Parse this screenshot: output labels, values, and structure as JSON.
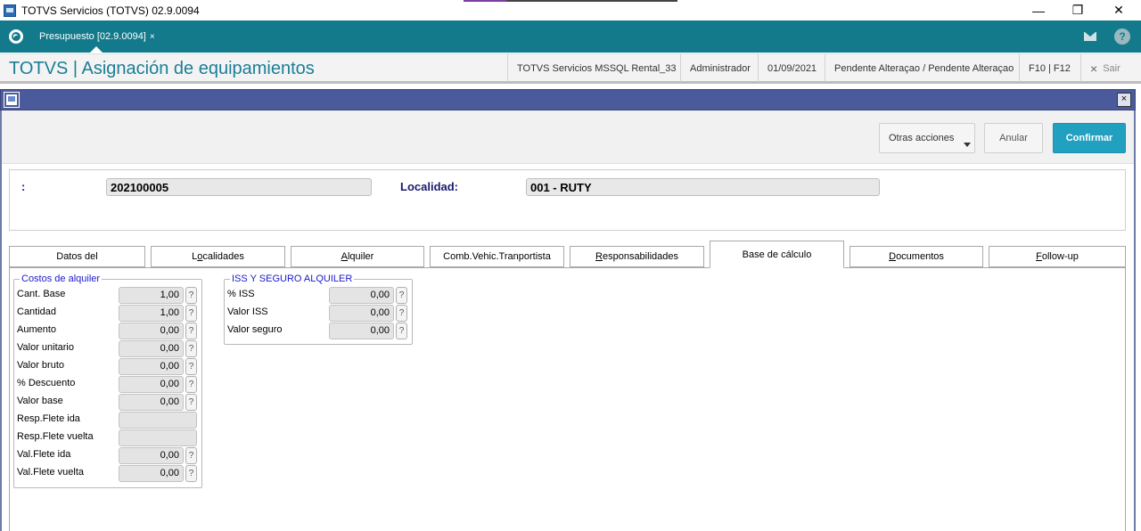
{
  "window": {
    "title": "TOTVS Servicios (TOTVS) 02.9.0094",
    "minimize": "—",
    "restore": "❐",
    "close": "✕"
  },
  "app_tabs": [
    {
      "label": "Presupuesto [02.9.0094]",
      "close": "×"
    }
  ],
  "header": {
    "title": "TOTVS | Asignación de equipamientos",
    "environment": "TOTVS Servicios MSSQL Rental_33",
    "user": "Administrador",
    "date": "01/09/2021",
    "status": "Pendente Alteraçao / Pendente Alteraçao",
    "shortcuts": "F10 | F12",
    "exit_label": "Sair",
    "exit_icon": "×",
    "help_icon": "?"
  },
  "toolbar": {
    "other_actions": "Otras acciones",
    "cancel": "Anular",
    "confirm": "Confirmar"
  },
  "dialog": {
    "close": "×"
  },
  "fields": {
    "number_label": ":",
    "number_value": "202100005",
    "locality_label": "Localidad:",
    "locality_value": "001 - RUTY"
  },
  "tabs": [
    {
      "label_pre": "Datos del",
      "label_u": " ",
      "label_post": ""
    },
    {
      "label_pre": "L",
      "label_u": "o",
      "label_post": "calidades"
    },
    {
      "label_pre": "",
      "label_u": "A",
      "label_post": "lquiler"
    },
    {
      "label_pre": "Comb.Vehic.Tranportista",
      "label_u": "",
      "label_post": ""
    },
    {
      "label_pre": "",
      "label_u": "R",
      "label_post": "esponsabilidades"
    },
    {
      "label_pre": "Base de cálculo",
      "label_u": "",
      "label_post": ""
    },
    {
      "label_pre": "",
      "label_u": "D",
      "label_post": "ocumentos"
    },
    {
      "label_pre": "",
      "label_u": "F",
      "label_post": "ollow-up"
    }
  ],
  "active_tab": "Base de cálculo",
  "costos": {
    "title": "Costos de alquiler",
    "rows": [
      {
        "label": "Cant. Base",
        "value": "1,00",
        "help": "?"
      },
      {
        "label": "Cantidad",
        "value": "1,00",
        "help": "?"
      },
      {
        "label": "Aumento",
        "value": "0,00",
        "help": "?"
      },
      {
        "label": "Valor unitario",
        "value": "0,00",
        "help": "?"
      },
      {
        "label": "Valor bruto",
        "value": "0,00",
        "help": "?"
      },
      {
        "label": "% Descuento",
        "value": "0,00",
        "help": "?"
      },
      {
        "label": "Valor base",
        "value": "0,00",
        "help": "?"
      },
      {
        "label": "Resp.Flete ida",
        "value": "",
        "help": ""
      },
      {
        "label": "Resp.Flete vuelta",
        "value": "",
        "help": ""
      },
      {
        "label": "Val.Flete ida",
        "value": "0,00",
        "help": "?"
      },
      {
        "label": "Val.Flete vuelta",
        "value": "0,00",
        "help": "?"
      }
    ]
  },
  "iss": {
    "title": "ISS Y SEGURO ALQUILER",
    "rows": [
      {
        "label": "% ISS",
        "value": "0,00",
        "help": "?"
      },
      {
        "label": "Valor ISS",
        "value": "0,00",
        "help": "?"
      },
      {
        "label": "Valor seguro",
        "value": "0,00",
        "help": "?"
      }
    ]
  },
  "colors": {
    "teal_bar": "#137a8c",
    "title_teal": "#1a7e96",
    "dialog_bar": "#4a5a9a",
    "confirm_button": "#21a0c0",
    "group_title": "#1a1acc"
  }
}
